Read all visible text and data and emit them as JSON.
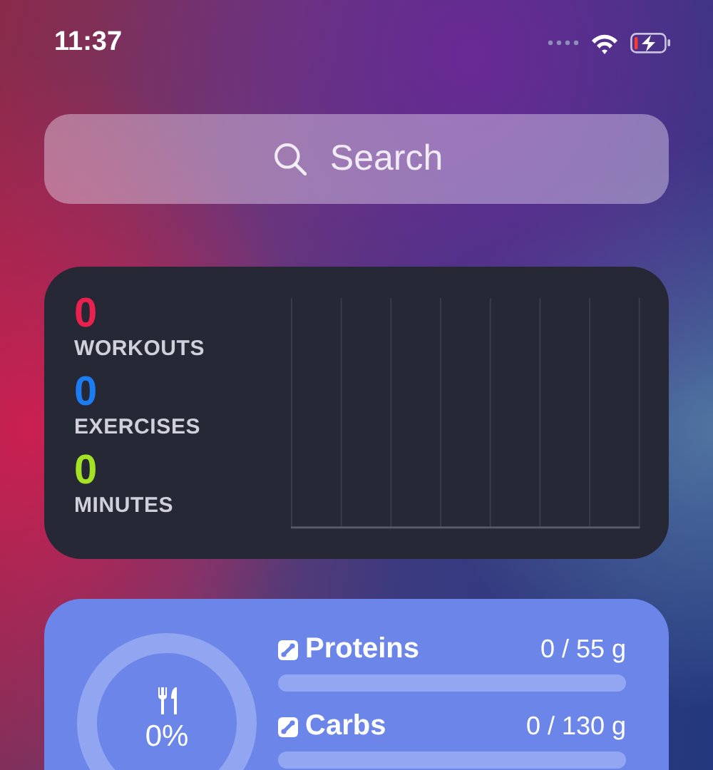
{
  "status_bar": {
    "time": "11:37"
  },
  "search": {
    "placeholder": "Search"
  },
  "activity_widget": {
    "stats": [
      {
        "value": "0",
        "label": "WORKOUTS",
        "color": "#e8214f"
      },
      {
        "value": "0",
        "label": "EXERCISES",
        "color": "#1c7df2"
      },
      {
        "value": "0",
        "label": "MINUTES",
        "color": "#a4e324"
      }
    ]
  },
  "nutrition_widget": {
    "ring": {
      "level": 0,
      "reading": "0%"
    },
    "macros": [
      {
        "name": "Proteins",
        "reading": "0 / 55 g",
        "level": 0
      },
      {
        "name": "Carbs",
        "reading": "0 / 130 g",
        "level": 0
      }
    ]
  }
}
